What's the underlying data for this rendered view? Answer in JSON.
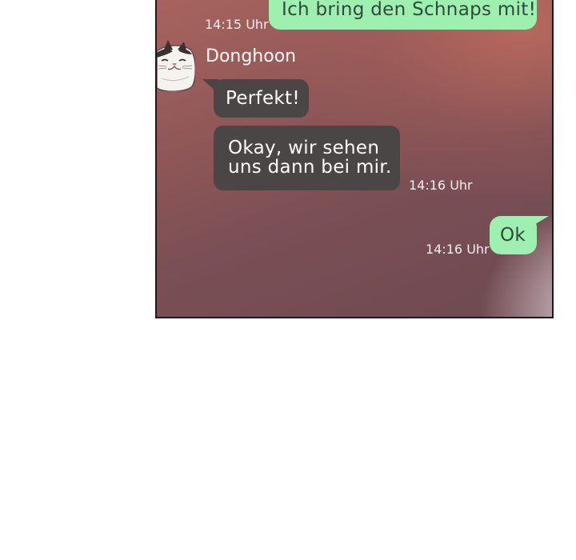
{
  "messages": {
    "sent_1": {
      "text": "Ich bring den Schnaps mit!",
      "time": "14:15 Uhr"
    },
    "sender_name": "Donghoon",
    "received_1": {
      "text": "Perfekt!"
    },
    "received_2": {
      "line1": "Okay, wir sehen",
      "line2": "uns dann bei mir.",
      "time": "14:16 Uhr"
    },
    "sent_2": {
      "text": "Ok",
      "time": "14:16 Uhr"
    }
  },
  "avatar": {
    "icon": "cat-avatar-icon"
  },
  "colors": {
    "sent_bubble": "#9ef0b1",
    "received_bubble": "#4a4646",
    "panel_border": "#1b1b1b"
  }
}
